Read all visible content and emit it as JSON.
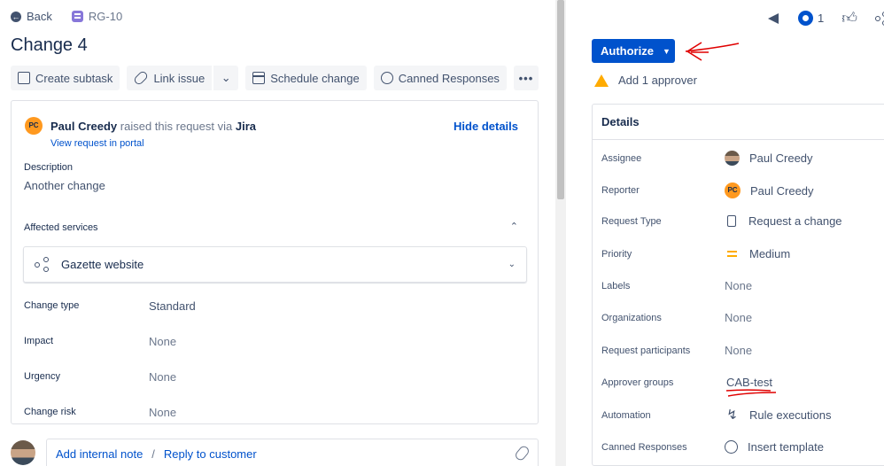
{
  "nav": {
    "back_label": "Back",
    "issue_key": "RG-10"
  },
  "issue": {
    "title": "Change 4"
  },
  "toolbar": {
    "create_subtask": "Create subtask",
    "link_issue": "Link issue",
    "schedule_change": "Schedule change",
    "canned_responses": "Canned Responses"
  },
  "request": {
    "reporter_initials": "PC",
    "reporter_name": "Paul Creedy",
    "raised_text": "raised this request via",
    "channel": "Jira",
    "view_portal": "View request in portal",
    "hide_details": "Hide details",
    "description_label": "Description",
    "description_value": "Another change",
    "affected_services_label": "Affected services",
    "service_name": "Gazette website",
    "fields": [
      {
        "label": "Change type",
        "value": "Standard"
      },
      {
        "label": "Impact",
        "value": "None"
      },
      {
        "label": "Urgency",
        "value": "None"
      },
      {
        "label": "Change risk",
        "value": "None"
      }
    ]
  },
  "comment": {
    "internal_note": "Add internal note",
    "separator": "/",
    "reply": "Reply to customer"
  },
  "header_right": {
    "watchers_count": "1"
  },
  "workflow": {
    "authorize_label": "Authorize",
    "approver_text": "Add 1 approver"
  },
  "details": {
    "heading": "Details",
    "rows": [
      {
        "label": "Assignee",
        "value": "Paul Creedy"
      },
      {
        "label": "Reporter",
        "value": "Paul Creedy",
        "initials": "PC"
      },
      {
        "label": "Request Type",
        "value": "Request a change"
      },
      {
        "label": "Priority",
        "value": "Medium"
      },
      {
        "label": "Labels",
        "value": "None"
      },
      {
        "label": "Organizations",
        "value": "None"
      },
      {
        "label": "Request participants",
        "value": "None"
      },
      {
        "label": "Approver groups",
        "value": "CAB-test"
      },
      {
        "label": "Automation",
        "value": "Rule executions"
      },
      {
        "label": "Canned Responses",
        "value": "Insert template"
      }
    ]
  },
  "colors": {
    "primary": "#0052cc",
    "text": "#172b4d",
    "annotation": "#e00000",
    "warning": "#ffab00"
  }
}
